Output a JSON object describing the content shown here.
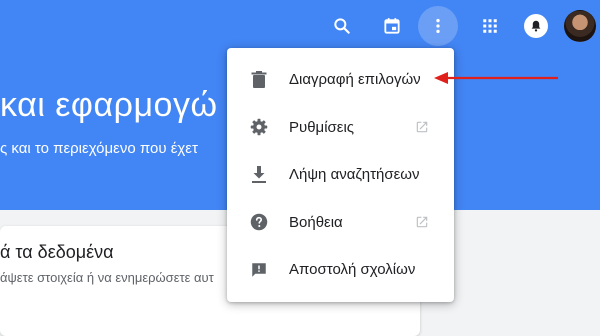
{
  "page": {
    "heading": "και εφαρμογώ",
    "subheading": "ς και το περιεχόμενο που έχετ",
    "card": {
      "title": "ά τα δεδομένα",
      "description": "άψετε στοιχεία ή να ενημερώσετε αυτ"
    }
  },
  "topbar": {
    "icons": [
      "search-icon",
      "calendar-icon",
      "more-vert-icon",
      "apps-grid-icon",
      "notifications-icon",
      "avatar"
    ]
  },
  "menu": {
    "items": [
      {
        "label": "Διαγραφή επιλογών",
        "icon": "trash-icon",
        "external": false
      },
      {
        "label": "Ρυθμίσεις",
        "icon": "gear-icon",
        "external": true
      },
      {
        "label": "Λήψη αναζητήσεων",
        "icon": "download-icon",
        "external": false
      },
      {
        "label": "Βοήθεια",
        "icon": "help-icon",
        "external": true
      },
      {
        "label": "Αποστολή σχολίων",
        "icon": "feedback-icon",
        "external": false
      }
    ]
  },
  "colors": {
    "header": "#4285f4",
    "background": "#f1f3f4",
    "menu_text": "#202124",
    "icon_gray": "#5f6368",
    "annotation_arrow": "#e0201b"
  }
}
